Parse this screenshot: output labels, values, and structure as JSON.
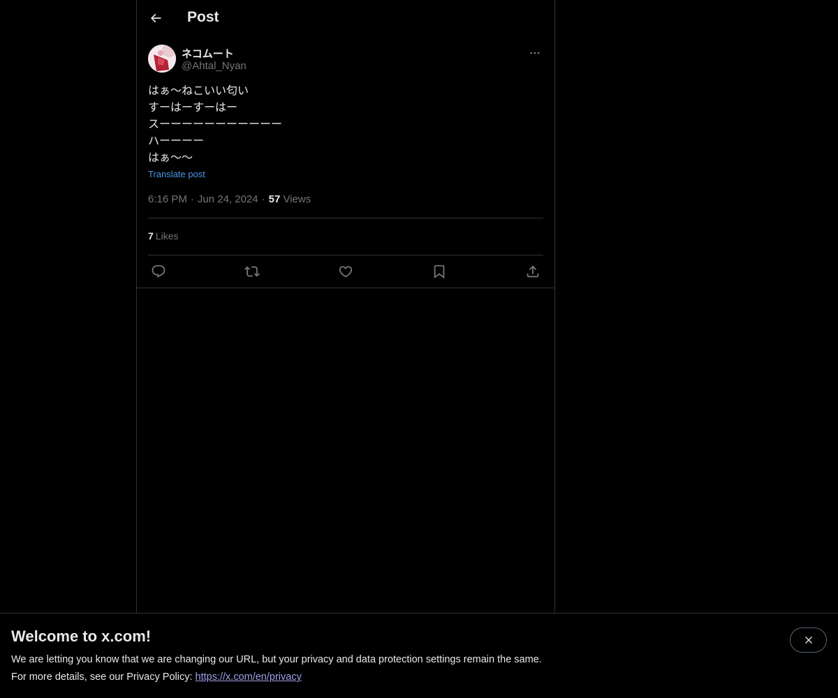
{
  "header": {
    "title": "Post"
  },
  "post": {
    "author": {
      "display_name": "ネコムート",
      "handle": "@Ahtal_Nyan"
    },
    "text_lines": [
      "はぁ〜ねこいい匂い",
      "すーはーすーはー",
      "スーーーーーーーーーーー",
      "ハーーーー",
      "はぁ〜〜"
    ],
    "translate_label": "Translate post",
    "time": "6:16 PM",
    "date": "Jun 24, 2024",
    "views_count": "57",
    "views_label": "Views",
    "likes_count": "7",
    "likes_label": "Likes"
  },
  "icons": {
    "back": "back-arrow-icon",
    "more": "more-icon",
    "reply": "reply-icon",
    "repost": "repost-icon",
    "like": "heart-icon",
    "bookmark": "bookmark-icon",
    "share": "share-icon",
    "close": "close-icon"
  },
  "banner": {
    "title": "Welcome to x.com!",
    "line1": "We are letting you know that we are changing our URL, but your privacy and data protection settings remain the same.",
    "line2_prefix": "For more details, see our Privacy Policy: ",
    "link_text": "https://x.com/en/privacy"
  },
  "colors": {
    "background": "#000000",
    "text_primary": "#e7e9ea",
    "text_secondary": "#71767b",
    "link_blue": "#4a99e9",
    "banner_link": "#a29fea",
    "border": "#2f3336"
  }
}
